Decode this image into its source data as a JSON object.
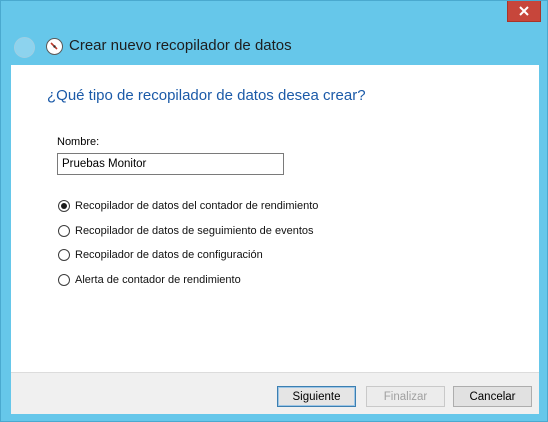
{
  "window": {
    "title": "Crear nuevo recopilador de datos",
    "close_icon": "close-icon",
    "back_icon": "back-arrow-icon",
    "app_icon": "performance-monitor-icon"
  },
  "main": {
    "question": "¿Qué tipo de recopilador de datos desea crear?",
    "name_label": "Nombre:",
    "name_value": "Pruebas Monitor",
    "options": [
      {
        "label": "Recopilador de datos del contador de rendimiento",
        "selected": true
      },
      {
        "label": "Recopilador de datos de seguimiento de eventos",
        "selected": false
      },
      {
        "label": "Recopilador de datos de configuración",
        "selected": false
      },
      {
        "label": "Alerta de contador de rendimiento",
        "selected": false
      }
    ]
  },
  "footer": {
    "next_label": "Siguiente",
    "finish_label": "Finalizar",
    "cancel_label": "Cancelar"
  },
  "colors": {
    "frame": "#66c7ea",
    "close_button": "#c7463b",
    "question_text": "#1b5aa8"
  }
}
